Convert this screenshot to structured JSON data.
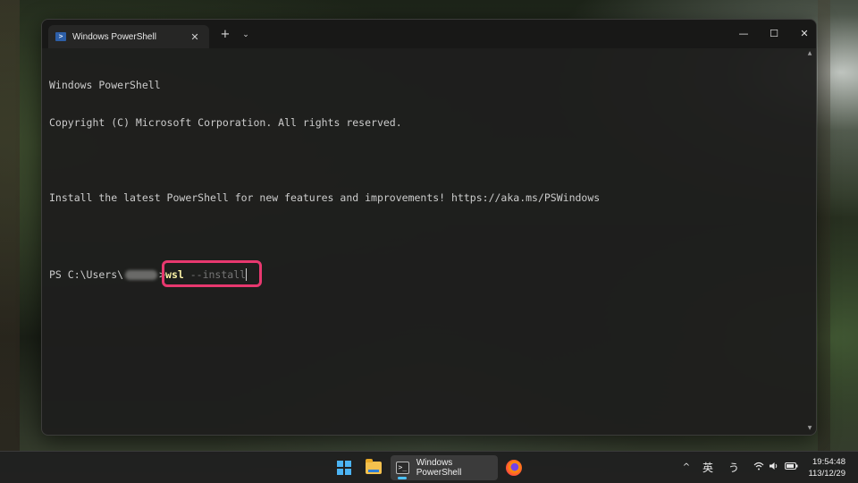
{
  "window": {
    "tab_title": "Windows PowerShell",
    "tab_close": "✕",
    "new_tab": "+",
    "dropdown": "⌄",
    "minimize": "—",
    "maximize": "☐",
    "close": "✕"
  },
  "console": {
    "lines": [
      "Windows PowerShell",
      "Copyright (C) Microsoft Corporation. All rights reserved.",
      "",
      "Install the latest PowerShell for new features and improvements! https://aka.ms/PSWindows",
      ""
    ],
    "prompt_prefix": "PS C:\\Users\\",
    "prompt_suffix": ">",
    "command": "wsl",
    "argument": " --install",
    "highlight_color": "#e8386f"
  },
  "taskbar": {
    "start_icon": "windows-logo-icon",
    "explorer_icon": "folder-icon",
    "active_app_label": "Windows PowerShell",
    "firefox_icon": "firefox-icon",
    "tray": {
      "chevron": "^",
      "ime_mode": "英",
      "ime_mode2": "う",
      "wifi": "wifi-icon",
      "sound": "speaker-icon",
      "battery": "battery-icon"
    },
    "clock": {
      "time": "19:54:48",
      "date": "113/12/29"
    }
  }
}
